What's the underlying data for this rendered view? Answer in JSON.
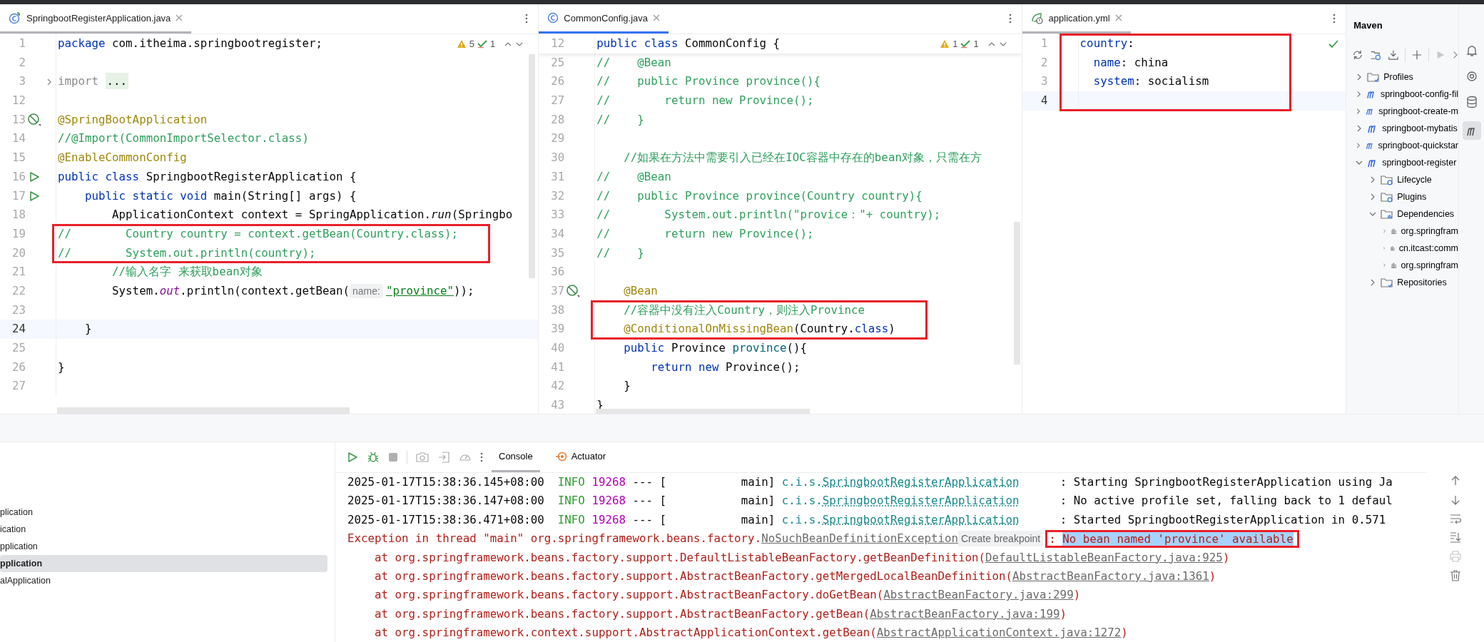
{
  "editors": [
    {
      "kind": "java",
      "focused": false,
      "tab": {
        "title": "SpringbootRegisterApplication.java"
      },
      "inspections": {
        "warnings": "5",
        "checks": "1"
      },
      "lines": [
        {
          "number": "1",
          "tokens": [
            {
              "text": "package",
              "kind": "kw"
            },
            {
              "text": " com.itheima.springbootregister;",
              "kind": "plain"
            }
          ]
        },
        {
          "number": "2"
        },
        {
          "number": "3",
          "kind": "fold",
          "tokens": [
            {
              "text": "import ",
              "kind": "folded"
            },
            {
              "text": "...",
              "kind": "placeholder"
            }
          ]
        },
        {
          "number": "12"
        },
        {
          "number": "13",
          "kind": "bean",
          "tokens": [
            {
              "text": "@SpringBootApplication",
              "kind": "annot"
            }
          ]
        },
        {
          "number": "14",
          "tokens": [
            {
              "text": "//@Import(CommonImportSelector.class)",
              "kind": "comment"
            }
          ]
        },
        {
          "number": "15",
          "tokens": [
            {
              "text": "@EnableCommonConfig",
              "kind": "annot"
            }
          ]
        },
        {
          "number": "16",
          "kind": "run",
          "tokens": [
            {
              "text": "public class",
              "kind": "kw"
            },
            {
              "text": " SpringbootRegisterApplication {",
              "kind": "plain"
            }
          ]
        },
        {
          "number": "17",
          "kind": "run",
          "tokens": [
            {
              "text": "    public static void",
              "kind": "kw"
            },
            {
              "text": " main(String[] args) {",
              "kind": "plain"
            }
          ]
        },
        {
          "number": "18",
          "tokens": [
            {
              "text": "        ApplicationContext context = SpringApplication.",
              "kind": "plain"
            },
            {
              "text": "run",
              "kind": "italic"
            },
            {
              "text": "(Springbo",
              "kind": "plain"
            }
          ]
        },
        {
          "number": "19",
          "boxed": true,
          "tokens": [
            {
              "text": "//        Country country = context.getBean(Country.class);",
              "kind": "comment"
            }
          ]
        },
        {
          "number": "20",
          "boxed": true,
          "tokens": [
            {
              "text": "//        System.out.println(country);",
              "kind": "comment"
            }
          ]
        },
        {
          "number": "21",
          "tokens": [
            {
              "text": "        //输入名字 来获取bean对象",
              "kind": "comment"
            }
          ]
        },
        {
          "number": "22",
          "tokens": [
            {
              "text": "        System.",
              "kind": "plain"
            },
            {
              "text": "out",
              "kind": "static"
            },
            {
              "text": ".println(context.getBean(",
              "kind": "plain"
            },
            {
              "text": "name:",
              "kind": "hint"
            },
            {
              "text": "\"province\"",
              "kind": "string"
            },
            {
              "text": "));",
              "kind": "plain"
            }
          ]
        },
        {
          "number": "23"
        },
        {
          "number": "24",
          "current": true,
          "tokens": [
            {
              "text": "    }",
              "kind": "plain"
            }
          ]
        },
        {
          "number": "25"
        },
        {
          "number": "26",
          "tokens": [
            {
              "text": "}",
              "kind": "plain"
            }
          ]
        },
        {
          "number": "27"
        }
      ]
    },
    {
      "kind": "java",
      "focused": true,
      "tab": {
        "title": "CommonConfig.java"
      },
      "inspections": {
        "warnings": "1",
        "checks": "1"
      },
      "lines": [
        {
          "number": "12",
          "sticky": true,
          "tokens": [
            {
              "text": "public class",
              "kind": "kw"
            },
            {
              "text": " CommonConfig {",
              "kind": "plain"
            }
          ]
        },
        {
          "number": "25",
          "tokens": [
            {
              "text": "//    @Bean",
              "kind": "comment"
            }
          ]
        },
        {
          "number": "26",
          "tokens": [
            {
              "text": "//    public Province province(){",
              "kind": "comment"
            }
          ]
        },
        {
          "number": "27",
          "tokens": [
            {
              "text": "//        return new Province();",
              "kind": "comment"
            }
          ]
        },
        {
          "number": "28",
          "tokens": [
            {
              "text": "//    }",
              "kind": "comment"
            }
          ]
        },
        {
          "number": "29"
        },
        {
          "number": "30",
          "tokens": [
            {
              "text": "    //如果在方法中需要引入已经在IOC容器中存在的bean对象，只需在方",
              "kind": "comment"
            }
          ]
        },
        {
          "number": "31",
          "tokens": [
            {
              "text": "//    @Bean",
              "kind": "comment"
            }
          ]
        },
        {
          "number": "32",
          "tokens": [
            {
              "text": "//    public Province province(Country country){",
              "kind": "comment"
            }
          ]
        },
        {
          "number": "33",
          "tokens": [
            {
              "text": "//        System.out.println(\"provice：\"+ country);",
              "kind": "comment"
            }
          ]
        },
        {
          "number": "34",
          "tokens": [
            {
              "text": "//        return new Province();",
              "kind": "comment"
            }
          ]
        },
        {
          "number": "35",
          "tokens": [
            {
              "text": "//    }",
              "kind": "comment"
            }
          ]
        },
        {
          "number": "36"
        },
        {
          "number": "37",
          "kind": "bean",
          "tokens": [
            {
              "text": "    @Bean",
              "kind": "annot"
            }
          ]
        },
        {
          "number": "38",
          "boxed": true,
          "tokens": [
            {
              "text": "    //容器中没有注入Country，则注入Province",
              "kind": "comment"
            }
          ]
        },
        {
          "number": "39",
          "boxed": true,
          "tokens": [
            {
              "text": "    @ConditionalOnMissingBean",
              "kind": "annot"
            },
            {
              "text": "(Country.",
              "kind": "plain"
            },
            {
              "text": "class",
              "kind": "kw"
            },
            {
              "text": ")",
              "kind": "plain"
            }
          ]
        },
        {
          "number": "40",
          "tokens": [
            {
              "text": "    public",
              "kind": "kw"
            },
            {
              "text": " Province ",
              "kind": "plain"
            },
            {
              "text": "province",
              "kind": "method"
            },
            {
              "text": "(){",
              "kind": "plain"
            }
          ]
        },
        {
          "number": "41",
          "tokens": [
            {
              "text": "        return new",
              "kind": "kw"
            },
            {
              "text": " Province();",
              "kind": "plain"
            }
          ]
        },
        {
          "number": "42",
          "tokens": [
            {
              "text": "    }",
              "kind": "plain"
            }
          ]
        },
        {
          "number": "43",
          "tokens": [
            {
              "text": "}",
              "kind": "plain"
            }
          ]
        }
      ]
    },
    {
      "kind": "yaml",
      "focused": false,
      "tab": {
        "title": "application.yml"
      },
      "valid": true,
      "lines": [
        {
          "number": "1",
          "boxed": true,
          "tokens": [
            {
              "text": "country",
              "kind": "key"
            },
            {
              "text": ":",
              "kind": "plain"
            }
          ]
        },
        {
          "number": "2",
          "boxed": true,
          "tokens": [
            {
              "text": "  name",
              "kind": "key"
            },
            {
              "text": ": china",
              "kind": "plain"
            }
          ]
        },
        {
          "number": "3",
          "boxed": true,
          "tokens": [
            {
              "text": "  system",
              "kind": "key"
            },
            {
              "text": ": socialism",
              "kind": "plain"
            }
          ]
        },
        {
          "number": "4",
          "boxed": true,
          "current": true
        }
      ]
    }
  ],
  "maven": {
    "title": "Maven",
    "tree": [
      {
        "label": "Profiles",
        "kind": "folder",
        "expanded": false
      },
      {
        "label": "springboot-config-fil",
        "kind": "module",
        "expanded": false
      },
      {
        "label": "springboot-create-m",
        "kind": "module",
        "expanded": false
      },
      {
        "label": "springboot-mybatis",
        "kind": "module",
        "expanded": false
      },
      {
        "label": "springboot-quickstar",
        "kind": "module",
        "expanded": false
      },
      {
        "label": "springboot-register",
        "kind": "module",
        "expanded": true,
        "children": [
          {
            "label": "Lifecycle",
            "kind": "gear-folder",
            "expanded": false
          },
          {
            "label": "Plugins",
            "kind": "gear-folder",
            "expanded": false
          },
          {
            "label": "Dependencies",
            "kind": "lib-folder",
            "expanded": true,
            "children": [
              {
                "label": "org.springfram",
                "kind": "library",
                "expanded": false
              },
              {
                "label": "cn.itcast:comm",
                "kind": "library",
                "expanded": false
              },
              {
                "label": "org.springfram",
                "kind": "library",
                "expanded": false
              }
            ]
          },
          {
            "label": "Repositories",
            "kind": "folder",
            "expanded": false
          }
        ]
      }
    ]
  },
  "services": [
    {
      "label": "plication",
      "selected": false
    },
    {
      "label": "ication",
      "selected": false
    },
    {
      "label": "pplication",
      "selected": false
    },
    {
      "label": "pplication",
      "selected": true
    },
    {
      "label": "alApplication",
      "selected": false
    }
  ],
  "console": {
    "tabs": [
      {
        "label": "Console",
        "selected": true
      },
      {
        "label": "Actuator",
        "selected": false
      }
    ],
    "lines": [
      {
        "tokens": [
          {
            "text": "2025-01-17T15:38:36.145+08:00",
            "kind": "text"
          },
          {
            "text": "  INFO",
            "kind": "level"
          },
          {
            "text": " 19268",
            "kind": "pid"
          },
          {
            "text": " --- [           main] ",
            "kind": "text"
          },
          {
            "text": "c.i.s.",
            "kind": "logger"
          },
          {
            "text": "SpringbootRegisterApplication",
            "kind": "logger-link"
          },
          {
            "text": "      : Starting SpringbootRegisterApplication using Ja",
            "kind": "text"
          }
        ]
      },
      {
        "tokens": [
          {
            "text": "2025-01-17T15:38:36.147+08:00",
            "kind": "text"
          },
          {
            "text": "  INFO",
            "kind": "level"
          },
          {
            "text": " 19268",
            "kind": "pid"
          },
          {
            "text": " --- [           main] ",
            "kind": "text"
          },
          {
            "text": "c.i.s.",
            "kind": "logger"
          },
          {
            "text": "SpringbootRegisterApplication",
            "kind": "logger-link"
          },
          {
            "text": "      : No active profile set, falling back to 1 defaul",
            "kind": "text"
          }
        ]
      },
      {
        "tokens": [
          {
            "text": "2025-01-17T15:38:36.471+08:00",
            "kind": "text"
          },
          {
            "text": "  INFO",
            "kind": "level"
          },
          {
            "text": " 19268",
            "kind": "pid"
          },
          {
            "text": " --- [           main] ",
            "kind": "text"
          },
          {
            "text": "c.i.s.",
            "kind": "logger"
          },
          {
            "text": "SpringbootRegisterApplication",
            "kind": "logger-link"
          },
          {
            "text": "      : Started SpringbootRegisterApplication in 0.571",
            "kind": "text"
          }
        ]
      },
      {
        "tokens": [
          {
            "text": "Exception in thread \"main\" org.springframework.beans.factory.",
            "kind": "error"
          },
          {
            "text": "NoSuchBeanDefinitionException",
            "kind": "link"
          },
          {
            "text": "Create breakpoint",
            "kind": "hint"
          },
          {
            "text": ": ",
            "kind": "error",
            "boxed": true
          },
          {
            "text": "No bean named 'province' available",
            "kind": "error",
            "boxed": true,
            "highlighted": true
          }
        ]
      },
      {
        "tokens": [
          {
            "text": "    at org.springframework.beans.factory.support.DefaultListableBeanFactory.getBeanDefinition(",
            "kind": "error"
          },
          {
            "text": "DefaultListableBeanFactory.java:925",
            "kind": "link"
          },
          {
            "text": ")",
            "kind": "error"
          }
        ]
      },
      {
        "tokens": [
          {
            "text": "    at org.springframework.beans.factory.support.AbstractBeanFactory.getMergedLocalBeanDefinition(",
            "kind": "error"
          },
          {
            "text": "AbstractBeanFactory.java:1361",
            "kind": "link"
          },
          {
            "text": ")",
            "kind": "error"
          }
        ]
      },
      {
        "tokens": [
          {
            "text": "    at org.springframework.beans.factory.support.AbstractBeanFactory.doGetBean(",
            "kind": "error"
          },
          {
            "text": "AbstractBeanFactory.java:299",
            "kind": "link"
          },
          {
            "text": ")",
            "kind": "error"
          }
        ]
      },
      {
        "tokens": [
          {
            "text": "    at org.springframework.beans.factory.support.AbstractBeanFactory.getBean(",
            "kind": "error"
          },
          {
            "text": "AbstractBeanFactory.java:199",
            "kind": "link"
          },
          {
            "text": ")",
            "kind": "error"
          }
        ]
      },
      {
        "tokens": [
          {
            "text": "    at org.springframework.context.support.AbstractApplicationContext.getBean(",
            "kind": "error"
          },
          {
            "text": "AbstractApplicationContext.java:1272",
            "kind": "link"
          },
          {
            "text": ")",
            "kind": "error"
          }
        ]
      }
    ]
  }
}
